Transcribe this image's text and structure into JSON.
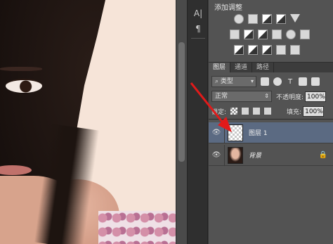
{
  "adjustments": {
    "title": "添加调整"
  },
  "tools": {
    "char_icon_text": "A|",
    "para_icon_text": "¶"
  },
  "layers_panel": {
    "tabs": [
      "图层",
      "通道",
      "路径"
    ],
    "filter": {
      "kind_label": "类型",
      "text_filter_glyph": "T"
    },
    "blend": {
      "mode": "正常",
      "opacity_label": "不透明度:",
      "opacity_value": "100%"
    },
    "lock": {
      "label": "锁定:",
      "fill_label": "填充:",
      "fill_value": "100%"
    },
    "layers": [
      {
        "name": "图层 1",
        "selected": true,
        "thumbnail": "transparent"
      },
      {
        "name": "背景",
        "selected": false,
        "thumbnail": "photo",
        "locked": true
      }
    ]
  },
  "icons": {
    "eye": "👁",
    "lock": "🔒",
    "search": "⌕",
    "chevron": "⌃"
  },
  "colors": {
    "selection": "#5b6a82",
    "annotation_arrow": "#e11a1a"
  }
}
